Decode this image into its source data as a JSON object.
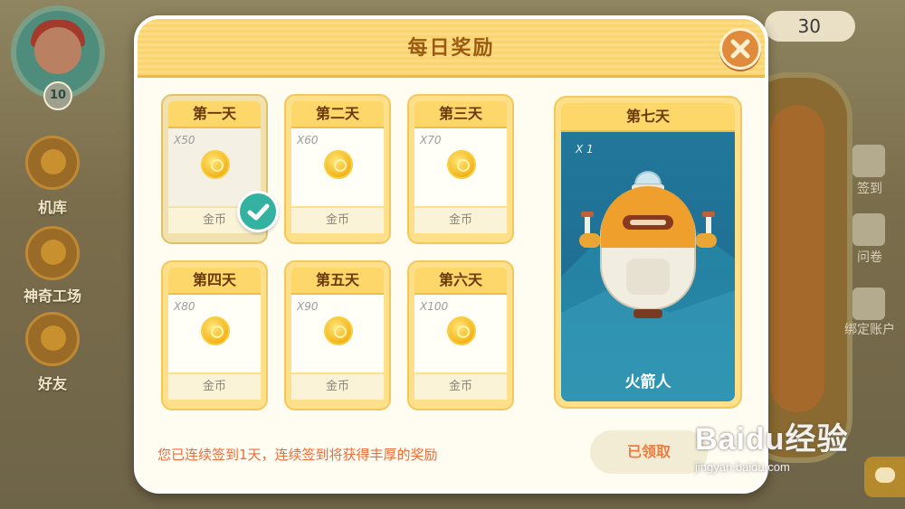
{
  "background": {
    "top_counter": "30",
    "player_level": "10",
    "side_menu": [
      {
        "label": "机库",
        "icon": "hangar-icon"
      },
      {
        "label": "神奇工场",
        "icon": "factory-icon"
      },
      {
        "label": "好友",
        "icon": "friends-icon"
      }
    ],
    "right_menu": [
      {
        "label": "签到",
        "icon": "calendar-check-icon"
      },
      {
        "label": "问卷",
        "icon": "bird-icon"
      },
      {
        "label": "绑定账户",
        "icon": "id-card-icon"
      }
    ]
  },
  "dialog": {
    "title": "每日奖励",
    "days": [
      {
        "label": "第一天",
        "qty": "X50",
        "reward": "金币",
        "claimed": true
      },
      {
        "label": "第二天",
        "qty": "X60",
        "reward": "金币",
        "claimed": false
      },
      {
        "label": "第三天",
        "qty": "X70",
        "reward": "金币",
        "claimed": false
      },
      {
        "label": "第四天",
        "qty": "X80",
        "reward": "金币",
        "claimed": false
      },
      {
        "label": "第五天",
        "qty": "X90",
        "reward": "金币",
        "claimed": false
      },
      {
        "label": "第六天",
        "qty": "X100",
        "reward": "金币",
        "claimed": false
      }
    ],
    "grand_prize": {
      "label": "第七天",
      "qty": "X 1",
      "reward": "火箭人"
    },
    "notice": "您已连续签到1天，连续签到将获得丰厚的奖励",
    "claim_button": "已领取"
  },
  "watermark": {
    "brand": "Baidu经验",
    "url": "jingyan.baidu.com"
  },
  "colors": {
    "header": "#fbd46e",
    "title": "#9b5a12",
    "accent_orange": "#f06a36",
    "check_teal": "#33b2a1",
    "prize_blue": "#21779a"
  }
}
